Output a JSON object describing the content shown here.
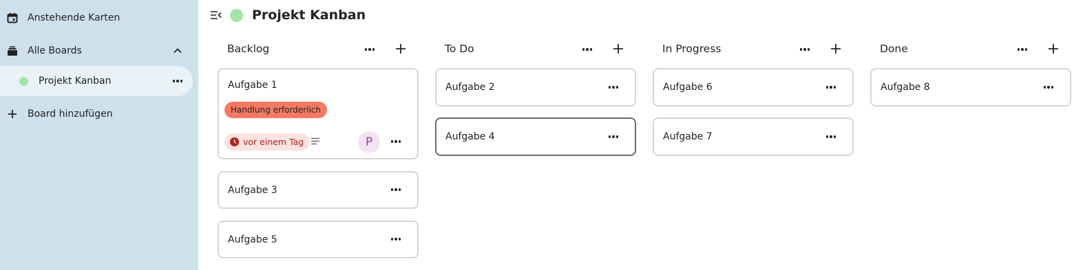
{
  "sidebar": {
    "items": [
      {
        "label": "Anstehende Karten",
        "icon": "calendar-icon"
      },
      {
        "label": "Alle Boards",
        "icon": "boards-stack-icon"
      },
      {
        "label": "Projekt Kanban",
        "icon": "board-color-dot",
        "color": "#a3e4a8"
      },
      {
        "label": "Board hinzufügen",
        "icon": "plus-icon"
      }
    ]
  },
  "header": {
    "title": "Projekt Kanban",
    "board_color": "#a3e4a8"
  },
  "columns": [
    {
      "title": "Backlog",
      "cards": [
        {
          "title": "Aufgabe 1",
          "label": "Handlung erforderlich",
          "label_color": "#f47a63",
          "due": "vor einem Tag",
          "has_description": true,
          "assignee_initial": "P"
        },
        {
          "title": "Aufgabe 3"
        },
        {
          "title": "Aufgabe 5"
        }
      ]
    },
    {
      "title": "To Do",
      "cards": [
        {
          "title": "Aufgabe 2"
        },
        {
          "title": "Aufgabe 4"
        }
      ]
    },
    {
      "title": "In Progress",
      "cards": [
        {
          "title": "Aufgabe 6"
        },
        {
          "title": "Aufgabe 7"
        }
      ]
    },
    {
      "title": "Done",
      "cards": [
        {
          "title": "Aufgabe 8"
        }
      ]
    }
  ]
}
